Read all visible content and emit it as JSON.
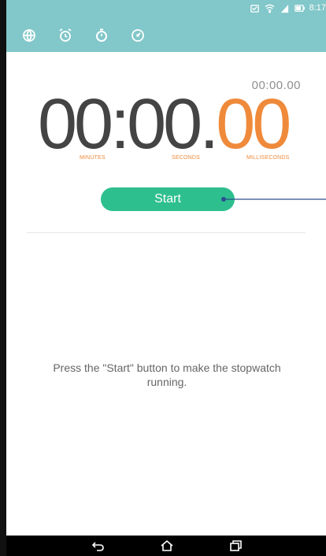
{
  "status_bar": {
    "time": "8:17"
  },
  "tabs": [
    {
      "name": "world-clock",
      "icon": "globe-icon"
    },
    {
      "name": "alarm",
      "icon": "alarm-clock-icon"
    },
    {
      "name": "stopwatch",
      "icon": "stopwatch-icon",
      "active": true
    },
    {
      "name": "timer",
      "icon": "timer-icon"
    }
  ],
  "stopwatch": {
    "lap_time": "00:00.00",
    "minutes": "00",
    "colon": ":",
    "seconds": "00",
    "dot": ".",
    "milliseconds": "00",
    "labels": {
      "minutes": "MINUTES",
      "seconds": "SECONDS",
      "milliseconds": "MILLISECONDS"
    },
    "start_label": "Start",
    "hint": "Press the \"Start\" button to make the stopwatch running."
  },
  "colors": {
    "header": "#82c7c9",
    "accent_orange": "#ef8a3b",
    "button_green": "#2ebf8f",
    "callout_blue": "#2a4f8f"
  },
  "navigation": {
    "back": "back-icon",
    "home": "home-icon",
    "recent": "recent-apps-icon"
  }
}
